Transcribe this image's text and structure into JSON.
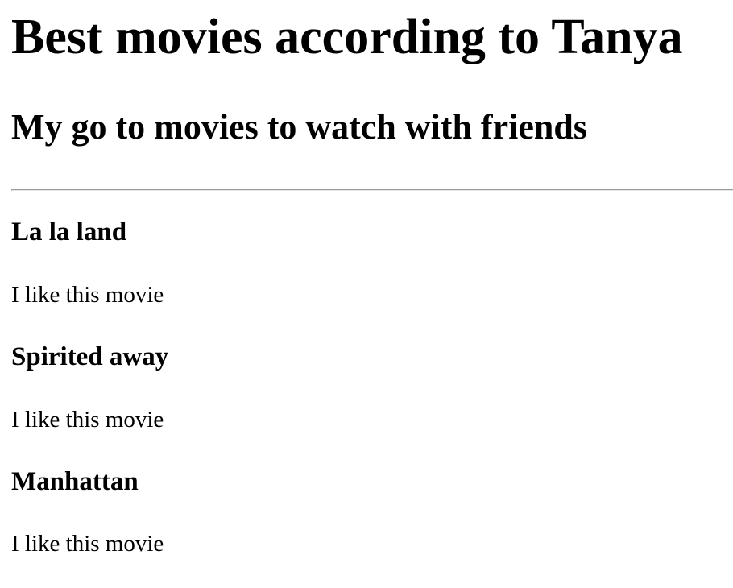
{
  "page": {
    "title": "Best movies according to Tanya",
    "subtitle": "My go to movies to watch with friends"
  },
  "movies": [
    {
      "title": "La la land",
      "description": "I like this movie"
    },
    {
      "title": "Spirited away",
      "description": "I like this movie"
    },
    {
      "title": "Manhattan",
      "description": "I like this movie"
    }
  ]
}
